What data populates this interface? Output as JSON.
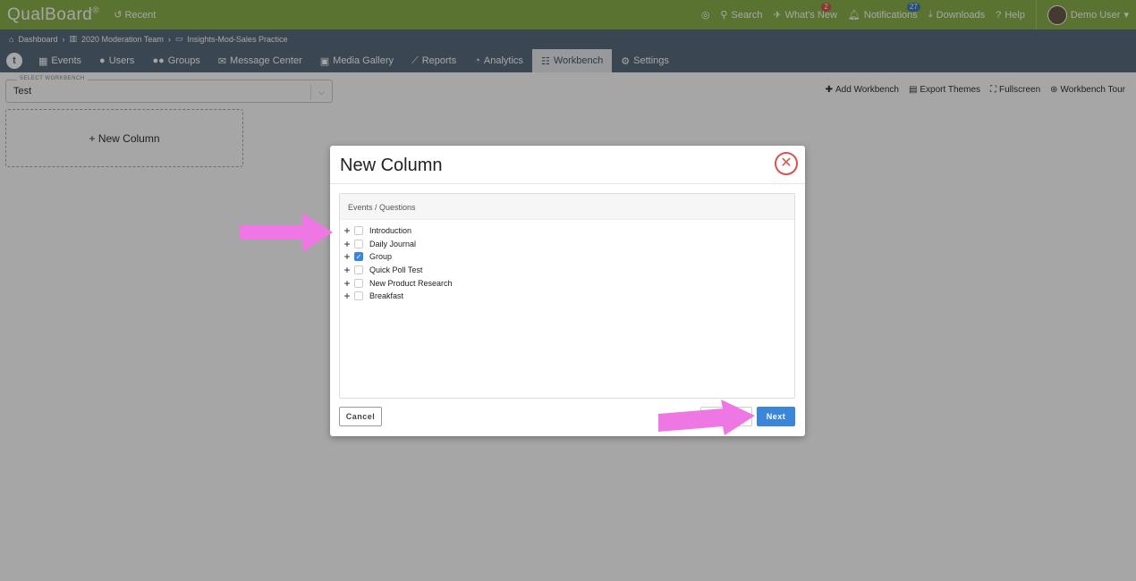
{
  "app": {
    "logo": "QualBoard",
    "logo_mark": "®",
    "recent_label": "Recent"
  },
  "topbar": {
    "search_label": "Search",
    "whats_new_label": "What's New",
    "whats_new_count": "2",
    "notifications_label": "Notifications",
    "notifications_count": "27",
    "downloads_label": "Downloads",
    "help_label": "Help",
    "user_label": "Demo User"
  },
  "breadcrumb": [
    "Dashboard",
    "2020 Moderation Team",
    "Insights-Mod-Sales Practice"
  ],
  "tabs": [
    {
      "label": "Events"
    },
    {
      "label": "Users"
    },
    {
      "label": "Groups"
    },
    {
      "label": "Message Center"
    },
    {
      "label": "Media Gallery"
    },
    {
      "label": "Reports"
    },
    {
      "label": "Analytics"
    },
    {
      "label": "Workbench"
    },
    {
      "label": "Settings"
    }
  ],
  "workbench": {
    "select_label": "SELECT WORKBENCH",
    "select_value": "Test",
    "add_workbench": "Add Workbench",
    "export_themes": "Export Themes",
    "fullscreen": "Fullscreen",
    "workbench_tour": "Workbench Tour",
    "new_column": "+ New Column"
  },
  "modal": {
    "title": "New Column",
    "panel_header": "Events / Questions",
    "items": [
      {
        "label": "Introduction",
        "checked": false
      },
      {
        "label": "Daily Journal",
        "checked": false
      },
      {
        "label": "Group",
        "checked": true
      },
      {
        "label": "Quick Poll Test",
        "checked": false
      },
      {
        "label": "New Product Research",
        "checked": false
      },
      {
        "label": "Breakfast",
        "checked": false
      }
    ],
    "cancel_label": "Cancel",
    "next_label": "Next"
  },
  "colors": {
    "topbar": "#8bb14a",
    "navbar": "#5a6e7e",
    "primary": "#3b86d9",
    "close": "#d9534f",
    "annotation_arrow": "#ee77e4"
  }
}
